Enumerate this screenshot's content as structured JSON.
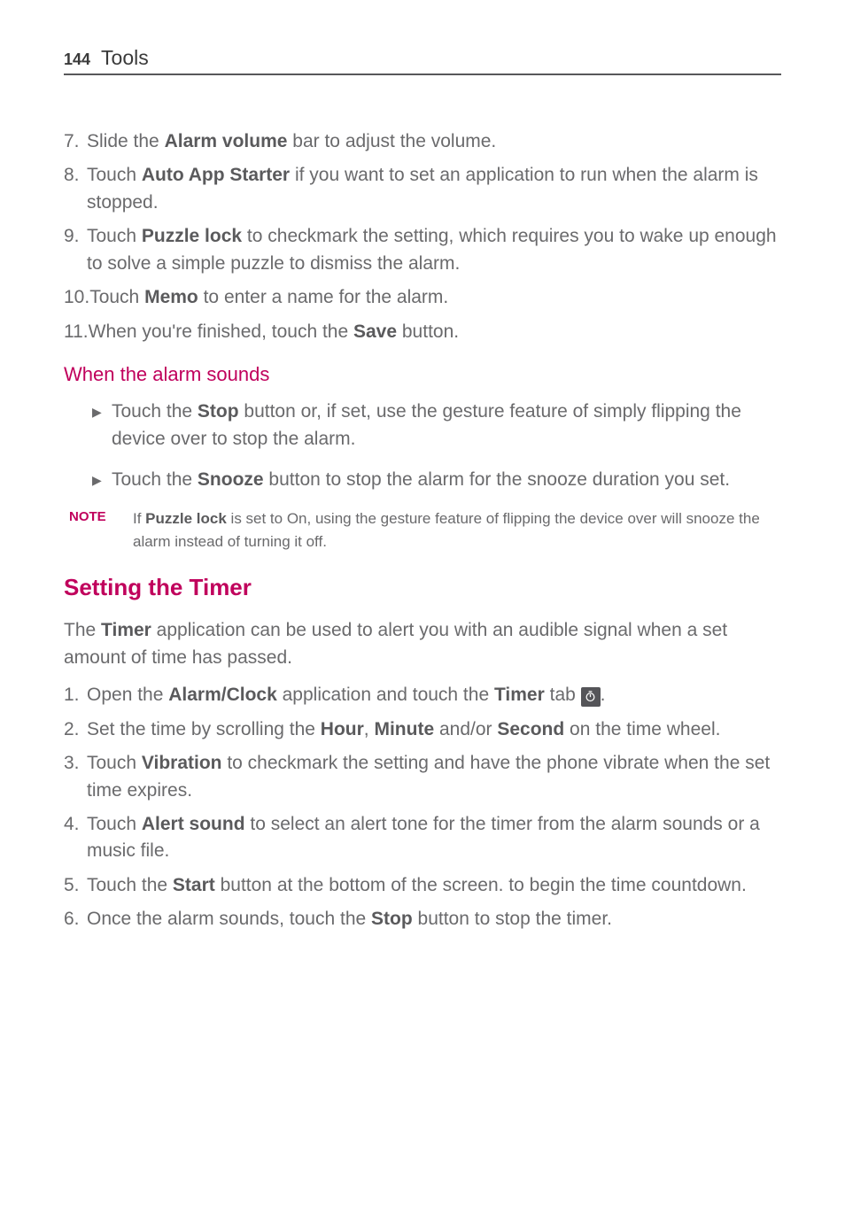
{
  "header": {
    "page_number": "144",
    "section": "Tools"
  },
  "continuation_list": {
    "items": [
      {
        "num": "7.",
        "pre": "Slide the ",
        "bold": "Alarm volume",
        "post": " bar to adjust the volume."
      },
      {
        "num": "8.",
        "pre": "Touch ",
        "bold": "Auto App Starter",
        "post": " if you want to set an application to run when the alarm is stopped."
      },
      {
        "num": "9.",
        "pre": "Touch ",
        "bold": "Puzzle lock",
        "post": " to checkmark the setting, which requires you to wake up enough to solve a simple puzzle to dismiss the alarm."
      },
      {
        "num": "10.",
        "pre": "Touch ",
        "bold": "Memo",
        "post": " to enter a name for the alarm."
      },
      {
        "num": "11.",
        "pre": " When you're finished, touch the ",
        "bold": "Save",
        "post": " button."
      }
    ]
  },
  "alarm_sounds": {
    "heading": "When the alarm sounds",
    "bullets": [
      {
        "pre": "Touch the ",
        "bold": "Stop",
        "post": " button or, if set, use the gesture feature of simply flipping the device over to stop the alarm."
      },
      {
        "pre": "Touch the ",
        "bold": "Snooze",
        "post": " button to stop the alarm for the snooze duration you set."
      }
    ],
    "note_label": "NOTE",
    "note_pre": "If ",
    "note_bold": "Puzzle lock",
    "note_post": " is set to On, using the gesture feature of flipping the device over will snooze the alarm instead of turning it off."
  },
  "timer": {
    "heading": "Setting the Timer",
    "intro_pre": "The ",
    "intro_bold": "Timer",
    "intro_post": " application can be used to alert you with an audible signal when a set amount of time has passed.",
    "steps": [
      {
        "num": "1.",
        "parts": [
          {
            "t": "Open the "
          },
          {
            "b": "Alarm/Clock"
          },
          {
            "t": " application and touch the "
          },
          {
            "b": "Timer"
          },
          {
            "t": " tab "
          },
          {
            "icon": true
          },
          {
            "t": "."
          }
        ]
      },
      {
        "num": "2.",
        "parts": [
          {
            "t": "Set the time by scrolling the "
          },
          {
            "b": "Hour"
          },
          {
            "t": ", "
          },
          {
            "b": "Minute"
          },
          {
            "t": " and/or "
          },
          {
            "b": "Second"
          },
          {
            "t": " on the time wheel."
          }
        ]
      },
      {
        "num": "3.",
        "parts": [
          {
            "t": "Touch "
          },
          {
            "b": "Vibration"
          },
          {
            "t": " to checkmark the setting and have the phone vibrate when the set time expires."
          }
        ]
      },
      {
        "num": "4.",
        "parts": [
          {
            "t": "Touch "
          },
          {
            "b": "Alert sound"
          },
          {
            "t": " to select an alert tone for the timer from the alarm sounds or a music file."
          }
        ]
      },
      {
        "num": "5.",
        "parts": [
          {
            "t": "Touch the "
          },
          {
            "b": "Start"
          },
          {
            "t": " button at the bottom of the screen. to begin the time countdown."
          }
        ]
      },
      {
        "num": "6.",
        "parts": [
          {
            "t": "Once the alarm sounds, touch the "
          },
          {
            "b": "Stop"
          },
          {
            "t": " button to stop the timer."
          }
        ]
      }
    ]
  }
}
